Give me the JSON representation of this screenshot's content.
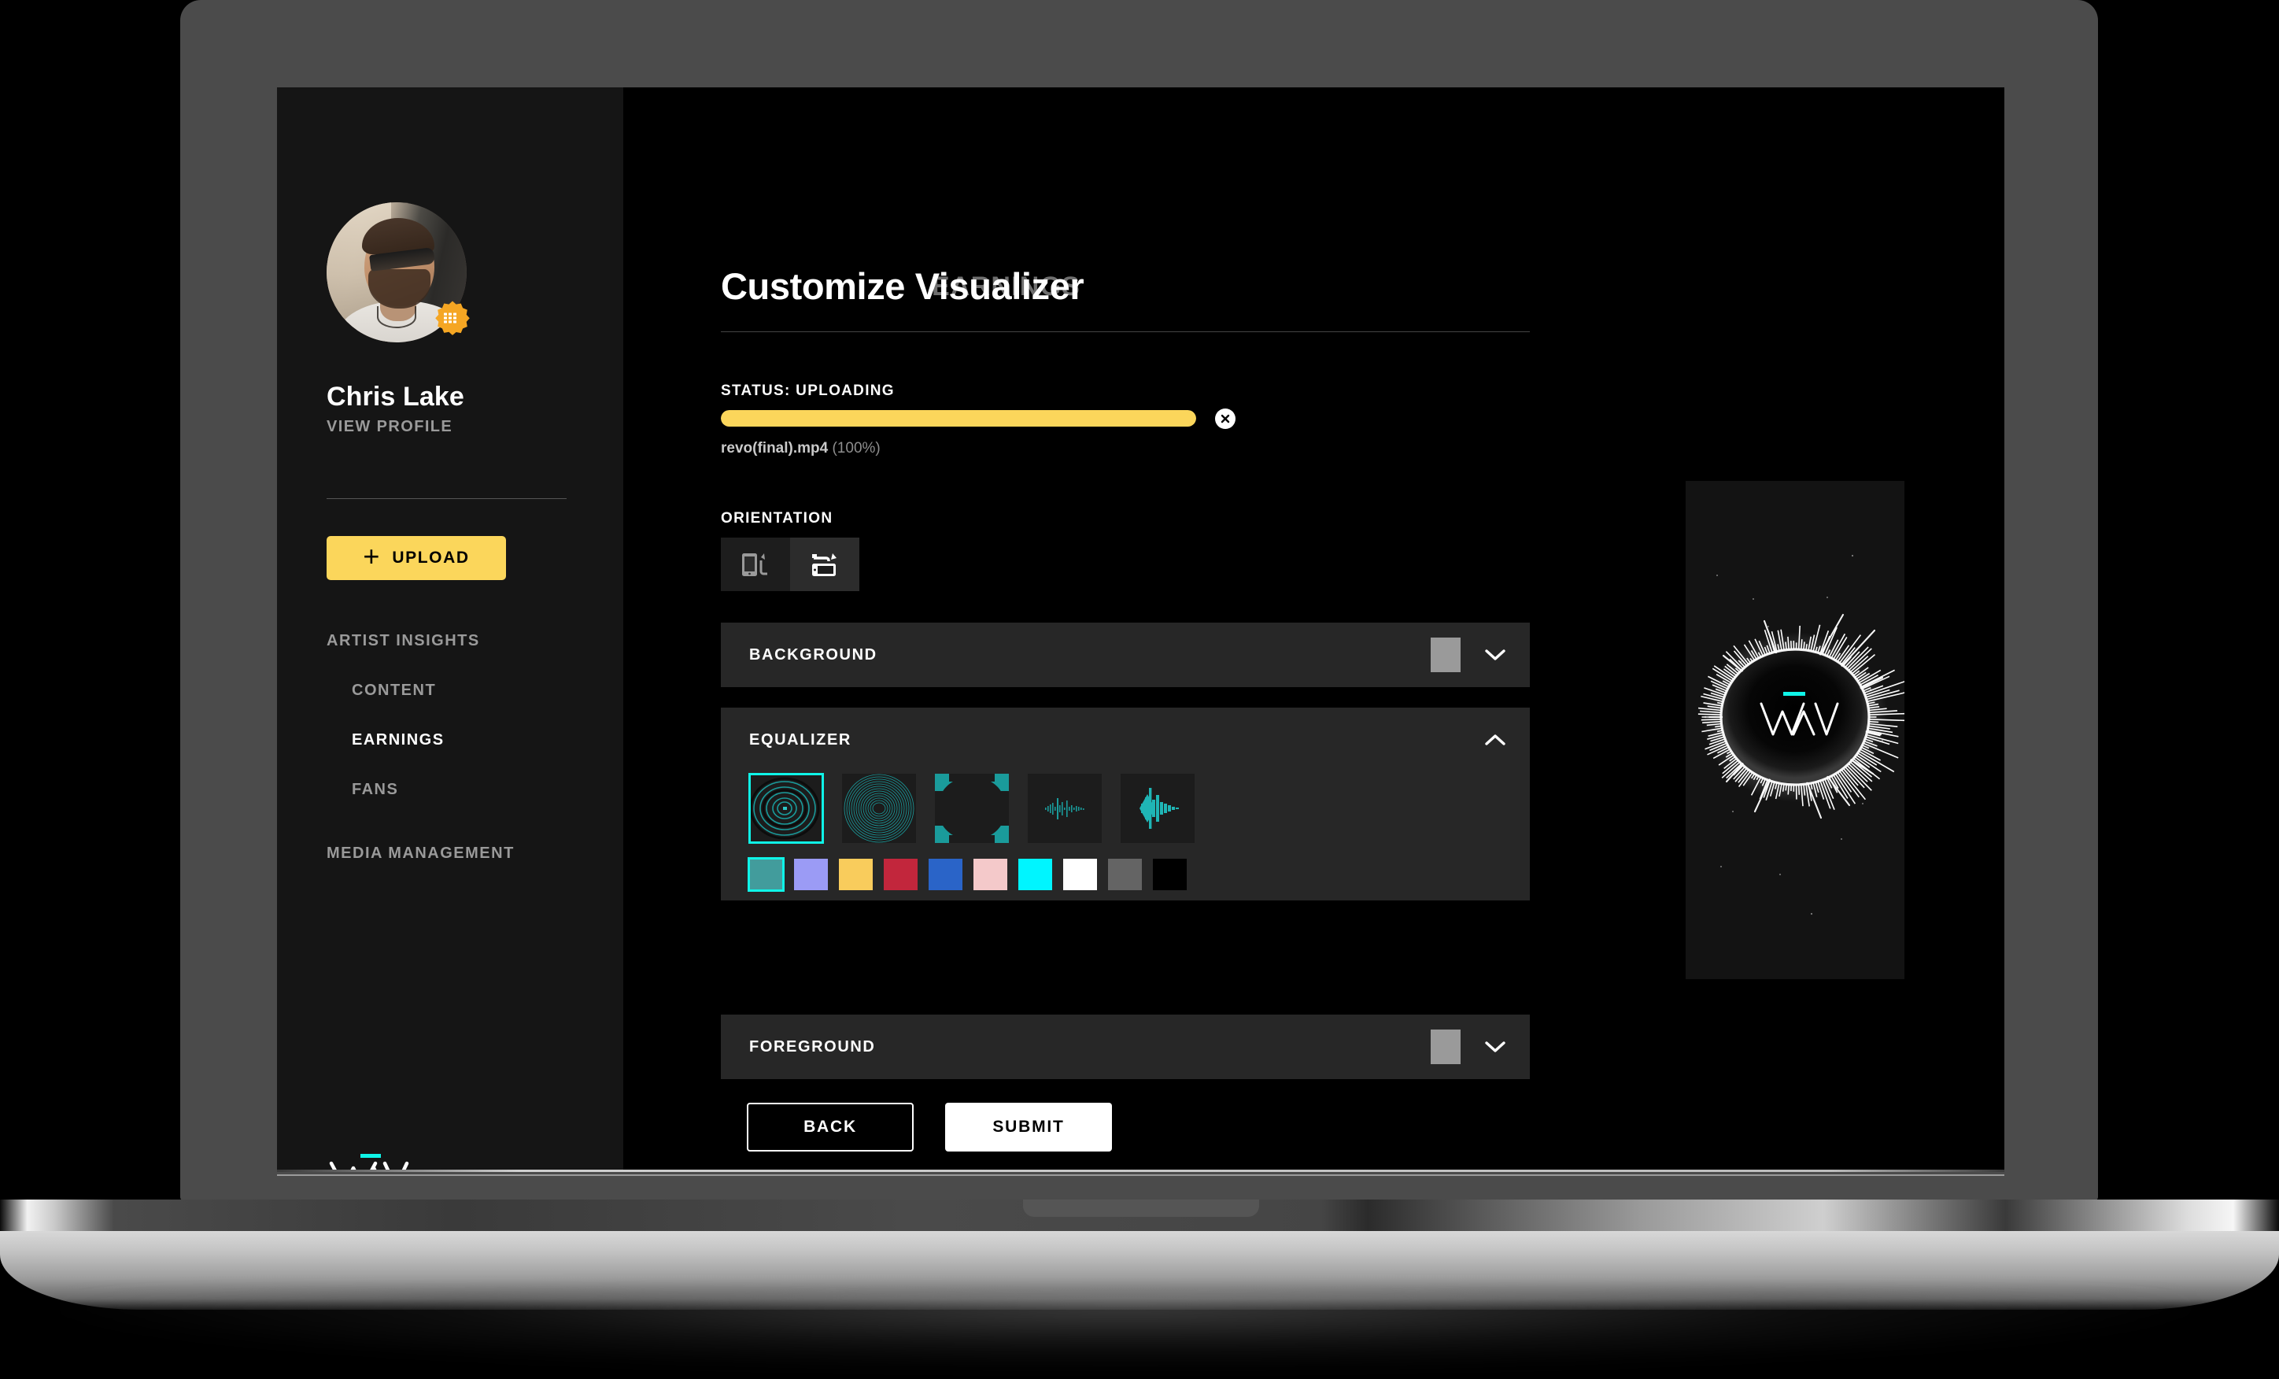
{
  "sidebar": {
    "profile": {
      "name": "Chris Lake",
      "view_profile_label": "VIEW PROFILE",
      "avatar_icon": "user-avatar-photo",
      "badge_icon": "verified-artist-badge-icon"
    },
    "upload_button": {
      "label": "UPLOAD",
      "icon": "plus-icon"
    },
    "nav": [
      {
        "label": "ARTIST INSIGHTS",
        "level": "group",
        "active": false
      },
      {
        "label": "CONTENT",
        "level": "sub",
        "active": false
      },
      {
        "label": "EARNINGS",
        "level": "sub",
        "active": true
      },
      {
        "label": "FANS",
        "level": "sub",
        "active": false
      },
      {
        "label": "MEDIA MANAGEMENT",
        "level": "group",
        "active": false
      }
    ],
    "logo": {
      "text": "WAV",
      "accent_color": "#0FF5E8"
    }
  },
  "main": {
    "title": "Customize Visualizer",
    "title_ghost": "EARNINGS",
    "status": {
      "label": "STATUS: UPLOADING",
      "progress_percent": 100,
      "bar_color": "#FBD65B",
      "close_icon": "close-x-icon",
      "file_name": "revo(final).mp4",
      "file_percent": "(100%)"
    },
    "orientation": {
      "label": "ORIENTATION",
      "options": [
        {
          "icon": "rotate-portrait-icon",
          "selected": false
        },
        {
          "icon": "rotate-landscape-icon",
          "selected": true
        }
      ]
    },
    "panels": {
      "background": {
        "title": "BACKGROUND",
        "swatch_color": "#9a9a9a",
        "chevron_icon": "chevron-down-icon",
        "expanded": false
      },
      "equalizer": {
        "title": "EQUALIZER",
        "chevron_icon": "chevron-up-icon",
        "expanded": true,
        "styles": [
          {
            "name": "concentric-rings-visualizer",
            "selected": true
          },
          {
            "name": "dense-radial-rings-visualizer",
            "selected": false
          },
          {
            "name": "rounded-square-arc-visualizer",
            "selected": false
          },
          {
            "name": "thin-waveform-visualizer",
            "selected": false
          },
          {
            "name": "bold-waveform-visualizer",
            "selected": false
          }
        ],
        "colors": [
          {
            "name": "teal",
            "hex": "#429C9C",
            "selected": true
          },
          {
            "name": "periwinkle",
            "hex": "#9B9BF5",
            "selected": false
          },
          {
            "name": "yellow",
            "hex": "#F9CC5C",
            "selected": false
          },
          {
            "name": "red",
            "hex": "#C2263C",
            "selected": false
          },
          {
            "name": "blue",
            "hex": "#2A64C8",
            "selected": false
          },
          {
            "name": "pink",
            "hex": "#F4C9CA",
            "selected": false
          },
          {
            "name": "cyan",
            "hex": "#00F5FF",
            "selected": false
          },
          {
            "name": "white",
            "hex": "#FFFFFF",
            "selected": false
          },
          {
            "name": "gray",
            "hex": "#646464",
            "selected": false
          },
          {
            "name": "black",
            "hex": "#000000",
            "selected": false
          }
        ]
      },
      "foreground": {
        "title": "FOREGROUND",
        "swatch_color": "#9a9a9a",
        "chevron_icon": "chevron-down-icon",
        "expanded": false
      }
    },
    "footer": {
      "back_label": "BACK",
      "submit_label": "SUBMIT"
    },
    "preview": {
      "logo_text": "WAV",
      "accent_color": "#0FF5E8",
      "background": "#131313"
    }
  }
}
